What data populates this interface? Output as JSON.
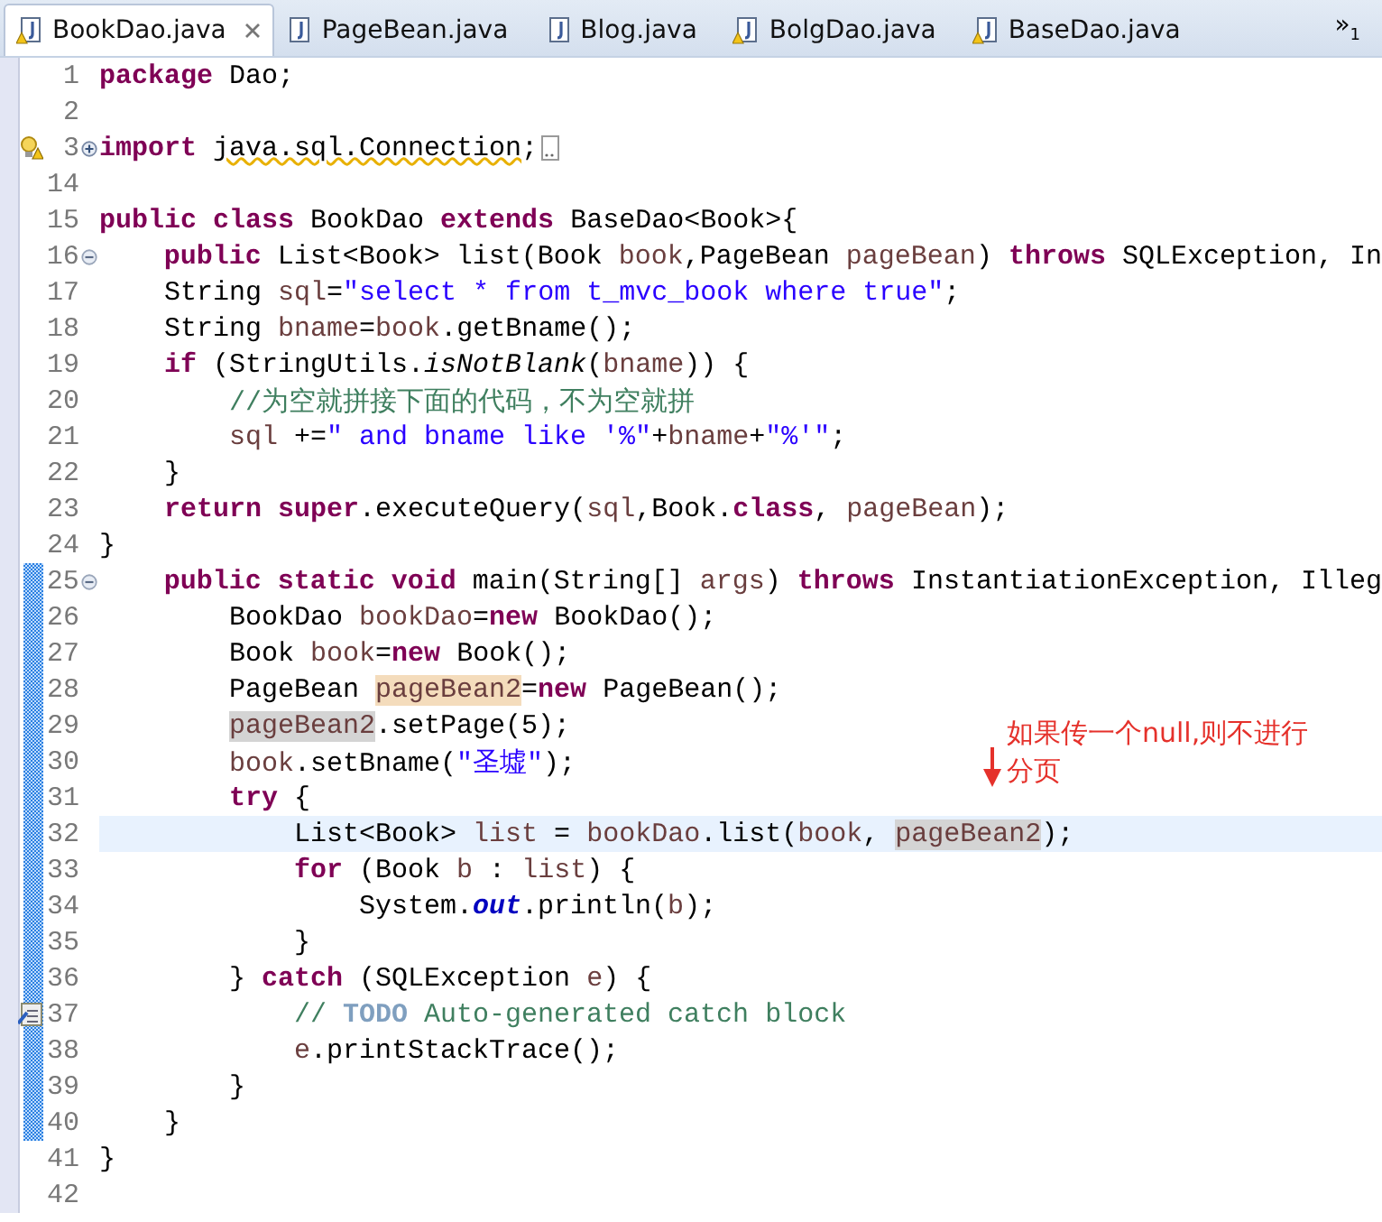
{
  "tabs": [
    {
      "label": "BookDao.java",
      "selected": true,
      "warning": true,
      "closable": true
    },
    {
      "label": "PageBean.java",
      "selected": false,
      "warning": false,
      "closable": false
    },
    {
      "label": "Blog.java",
      "selected": false,
      "warning": false,
      "closable": false
    },
    {
      "label": "BolgDao.java",
      "selected": false,
      "warning": true,
      "closable": false
    },
    {
      "label": "BaseDao.java",
      "selected": false,
      "warning": true,
      "closable": false
    }
  ],
  "tab_overflow": {
    "symbol": "»",
    "count": "1"
  },
  "editor": {
    "lines": [
      {
        "number": "1",
        "changed": false,
        "current": false,
        "tokens": [
          {
            "kind": "keyword",
            "text": "package"
          },
          {
            "kind": "plain",
            "text": " Dao;"
          }
        ]
      },
      {
        "number": "2",
        "changed": false,
        "current": false
      },
      {
        "number": "3",
        "changed": false,
        "current": false,
        "warning": true,
        "foldable": true,
        "collapsed": true,
        "folded_tail": true,
        "tokens": [
          {
            "kind": "keyword",
            "text": "import "
          },
          {
            "kind": "warning-underline",
            "text": "java.sql.Connection"
          },
          {
            "kind": "plain",
            "text": ";"
          }
        ]
      },
      {
        "number": "14",
        "changed": false,
        "current": false
      },
      {
        "number": "15",
        "changed": false,
        "current": false,
        "tokens": [
          {
            "kind": "keyword",
            "text": "public class"
          },
          {
            "kind": "plain",
            "text": " BookDao "
          },
          {
            "kind": "keyword",
            "text": "extends"
          },
          {
            "kind": "plain",
            "text": " BaseDao<Book>{"
          }
        ]
      },
      {
        "number": "16",
        "changed": false,
        "current": false,
        "foldable": true,
        "collapsed": false,
        "tokens": [
          {
            "kind": "keyword",
            "text": "    public"
          },
          {
            "kind": "plain",
            "text": " List<Book> list(Book "
          },
          {
            "kind": "variable",
            "text": "book"
          },
          {
            "kind": "plain",
            "text": ",PageBean "
          },
          {
            "kind": "variable",
            "text": "pageBean"
          },
          {
            "kind": "plain",
            "text": ") "
          },
          {
            "kind": "keyword",
            "text": "throws"
          },
          {
            "kind": "plain",
            "text": " SQLException, In"
          }
        ]
      },
      {
        "number": "17",
        "changed": false,
        "current": false,
        "tokens": [
          {
            "kind": "plain",
            "text": "    String "
          },
          {
            "kind": "variable",
            "text": "sql"
          },
          {
            "kind": "plain",
            "text": "="
          },
          {
            "kind": "string",
            "text": "\"select * from t_mvc_book where true\""
          },
          {
            "kind": "plain",
            "text": ";"
          }
        ]
      },
      {
        "number": "18",
        "changed": false,
        "current": false,
        "tokens": [
          {
            "kind": "plain",
            "text": "    String "
          },
          {
            "kind": "variable",
            "text": "bname"
          },
          {
            "kind": "plain",
            "text": "="
          },
          {
            "kind": "variable",
            "text": "book"
          },
          {
            "kind": "plain",
            "text": ".getBname();"
          }
        ]
      },
      {
        "number": "19",
        "changed": false,
        "current": false,
        "tokens": [
          {
            "kind": "keyword",
            "text": "    if"
          },
          {
            "kind": "plain",
            "text": " (StringUtils."
          },
          {
            "kind": "static-method",
            "text": "isNotBlank"
          },
          {
            "kind": "plain",
            "text": "("
          },
          {
            "kind": "variable",
            "text": "bname"
          },
          {
            "kind": "plain",
            "text": ")) {"
          }
        ]
      },
      {
        "number": "20",
        "changed": false,
        "current": false,
        "tokens": [
          {
            "kind": "comment",
            "text": "        //为空就拼接下面的代码，不为空就拼"
          }
        ]
      },
      {
        "number": "21",
        "changed": false,
        "current": false,
        "tokens": [
          {
            "kind": "variable",
            "text": "        sql"
          },
          {
            "kind": "plain",
            "text": " +="
          },
          {
            "kind": "string",
            "text": "\" and bname like '%\""
          },
          {
            "kind": "plain",
            "text": "+"
          },
          {
            "kind": "variable",
            "text": "bname"
          },
          {
            "kind": "plain",
            "text": "+"
          },
          {
            "kind": "string",
            "text": "\"%'\""
          },
          {
            "kind": "plain",
            "text": ";"
          }
        ]
      },
      {
        "number": "22",
        "changed": false,
        "current": false,
        "tokens": [
          {
            "kind": "plain",
            "text": "    }"
          }
        ]
      },
      {
        "number": "23",
        "changed": false,
        "current": false,
        "tokens": [
          {
            "kind": "keyword",
            "text": "    return super"
          },
          {
            "kind": "plain",
            "text": ".executeQuery("
          },
          {
            "kind": "variable",
            "text": "sql"
          },
          {
            "kind": "plain",
            "text": ",Book."
          },
          {
            "kind": "keyword",
            "text": "class"
          },
          {
            "kind": "plain",
            "text": ", "
          },
          {
            "kind": "variable",
            "text": "pageBean"
          },
          {
            "kind": "plain",
            "text": ");"
          }
        ]
      },
      {
        "number": "24",
        "changed": false,
        "current": false,
        "tokens": [
          {
            "kind": "plain",
            "text": "}"
          }
        ]
      },
      {
        "number": "25",
        "changed": true,
        "current": false,
        "foldable": true,
        "collapsed": false,
        "tokens": [
          {
            "kind": "keyword",
            "text": "    public static void"
          },
          {
            "kind": "plain",
            "text": " main(String[] "
          },
          {
            "kind": "variable",
            "text": "args"
          },
          {
            "kind": "plain",
            "text": ") "
          },
          {
            "kind": "keyword",
            "text": "throws"
          },
          {
            "kind": "plain",
            "text": " InstantiationException, Illeg"
          }
        ]
      },
      {
        "number": "26",
        "changed": true,
        "current": false,
        "tokens": [
          {
            "kind": "plain",
            "text": "        BookDao "
          },
          {
            "kind": "variable",
            "text": "bookDao"
          },
          {
            "kind": "plain",
            "text": "="
          },
          {
            "kind": "keyword",
            "text": "new"
          },
          {
            "kind": "plain",
            "text": " BookDao();"
          }
        ]
      },
      {
        "number": "27",
        "changed": true,
        "current": false,
        "tokens": [
          {
            "kind": "plain",
            "text": "        Book "
          },
          {
            "kind": "variable",
            "text": "book"
          },
          {
            "kind": "plain",
            "text": "="
          },
          {
            "kind": "keyword",
            "text": "new"
          },
          {
            "kind": "plain",
            "text": " Book();"
          }
        ]
      },
      {
        "number": "28",
        "changed": true,
        "current": false,
        "tokens": [
          {
            "kind": "plain",
            "text": "        PageBean "
          },
          {
            "kind": "write-occurrence",
            "text": "pageBean2"
          },
          {
            "kind": "plain",
            "text": "="
          },
          {
            "kind": "keyword",
            "text": "new"
          },
          {
            "kind": "plain",
            "text": " PageBean();"
          }
        ]
      },
      {
        "number": "29",
        "changed": true,
        "current": false,
        "tokens": [
          {
            "kind": "read-occurrence",
            "text": "        pageBean2"
          },
          {
            "kind": "plain",
            "text": ".setPage(5);"
          }
        ]
      },
      {
        "number": "30",
        "changed": true,
        "current": false,
        "tokens": [
          {
            "kind": "variable",
            "text": "        book"
          },
          {
            "kind": "plain",
            "text": ".setBname("
          },
          {
            "kind": "string",
            "text": "\"圣墟\""
          },
          {
            "kind": "plain",
            "text": ");"
          }
        ]
      },
      {
        "number": "31",
        "changed": true,
        "current": false,
        "tokens": [
          {
            "kind": "keyword",
            "text": "        try"
          },
          {
            "kind": "plain",
            "text": " {"
          }
        ]
      },
      {
        "number": "32",
        "changed": true,
        "current": true,
        "tokens": [
          {
            "kind": "plain",
            "text": "            List<Book> "
          },
          {
            "kind": "variable",
            "text": "list"
          },
          {
            "kind": "plain",
            "text": " = "
          },
          {
            "kind": "variable",
            "text": "bookDao"
          },
          {
            "kind": "plain",
            "text": ".list("
          },
          {
            "kind": "variable",
            "text": "book"
          },
          {
            "kind": "plain",
            "text": ", "
          },
          {
            "kind": "read-occurrence",
            "text": "pageBean2"
          },
          {
            "kind": "plain",
            "text": ");"
          }
        ]
      },
      {
        "number": "33",
        "changed": true,
        "current": false,
        "tokens": [
          {
            "kind": "keyword",
            "text": "            for"
          },
          {
            "kind": "plain",
            "text": " (Book "
          },
          {
            "kind": "variable",
            "text": "b"
          },
          {
            "kind": "plain",
            "text": " : "
          },
          {
            "kind": "variable",
            "text": "list"
          },
          {
            "kind": "plain",
            "text": ") {"
          }
        ]
      },
      {
        "number": "34",
        "changed": true,
        "current": false,
        "tokens": [
          {
            "kind": "plain",
            "text": "                System."
          },
          {
            "kind": "static-field",
            "text": "out"
          },
          {
            "kind": "plain",
            "text": ".println("
          },
          {
            "kind": "variable",
            "text": "b"
          },
          {
            "kind": "plain",
            "text": ");"
          }
        ]
      },
      {
        "number": "35",
        "changed": true,
        "current": false,
        "tokens": [
          {
            "kind": "plain",
            "text": "            }"
          }
        ]
      },
      {
        "number": "36",
        "changed": true,
        "current": false,
        "tokens": [
          {
            "kind": "plain",
            "text": "        } "
          },
          {
            "kind": "keyword",
            "text": "catch"
          },
          {
            "kind": "plain",
            "text": " (SQLException "
          },
          {
            "kind": "variable",
            "text": "e"
          },
          {
            "kind": "plain",
            "text": ") {"
          }
        ]
      },
      {
        "number": "37",
        "changed": true,
        "current": false,
        "task": true,
        "tokens": [
          {
            "kind": "comment",
            "text": "            // "
          },
          {
            "kind": "todo",
            "text": "TODO"
          },
          {
            "kind": "comment",
            "text": " Auto-generated catch block"
          }
        ]
      },
      {
        "number": "38",
        "changed": true,
        "current": false,
        "tokens": [
          {
            "kind": "variable",
            "text": "            e"
          },
          {
            "kind": "plain",
            "text": ".printStackTrace();"
          }
        ]
      },
      {
        "number": "39",
        "changed": true,
        "current": false,
        "tokens": [
          {
            "kind": "plain",
            "text": "        }"
          }
        ]
      },
      {
        "number": "40",
        "changed": true,
        "current": false,
        "tokens": [
          {
            "kind": "plain",
            "text": "    }"
          }
        ]
      },
      {
        "number": "41",
        "changed": false,
        "current": false,
        "tokens": [
          {
            "kind": "plain",
            "text": "}"
          }
        ]
      },
      {
        "number": "42",
        "changed": false,
        "current": false
      }
    ]
  },
  "annotation": {
    "lines": [
      "如果传一个null,则不进行",
      "分页"
    ]
  }
}
